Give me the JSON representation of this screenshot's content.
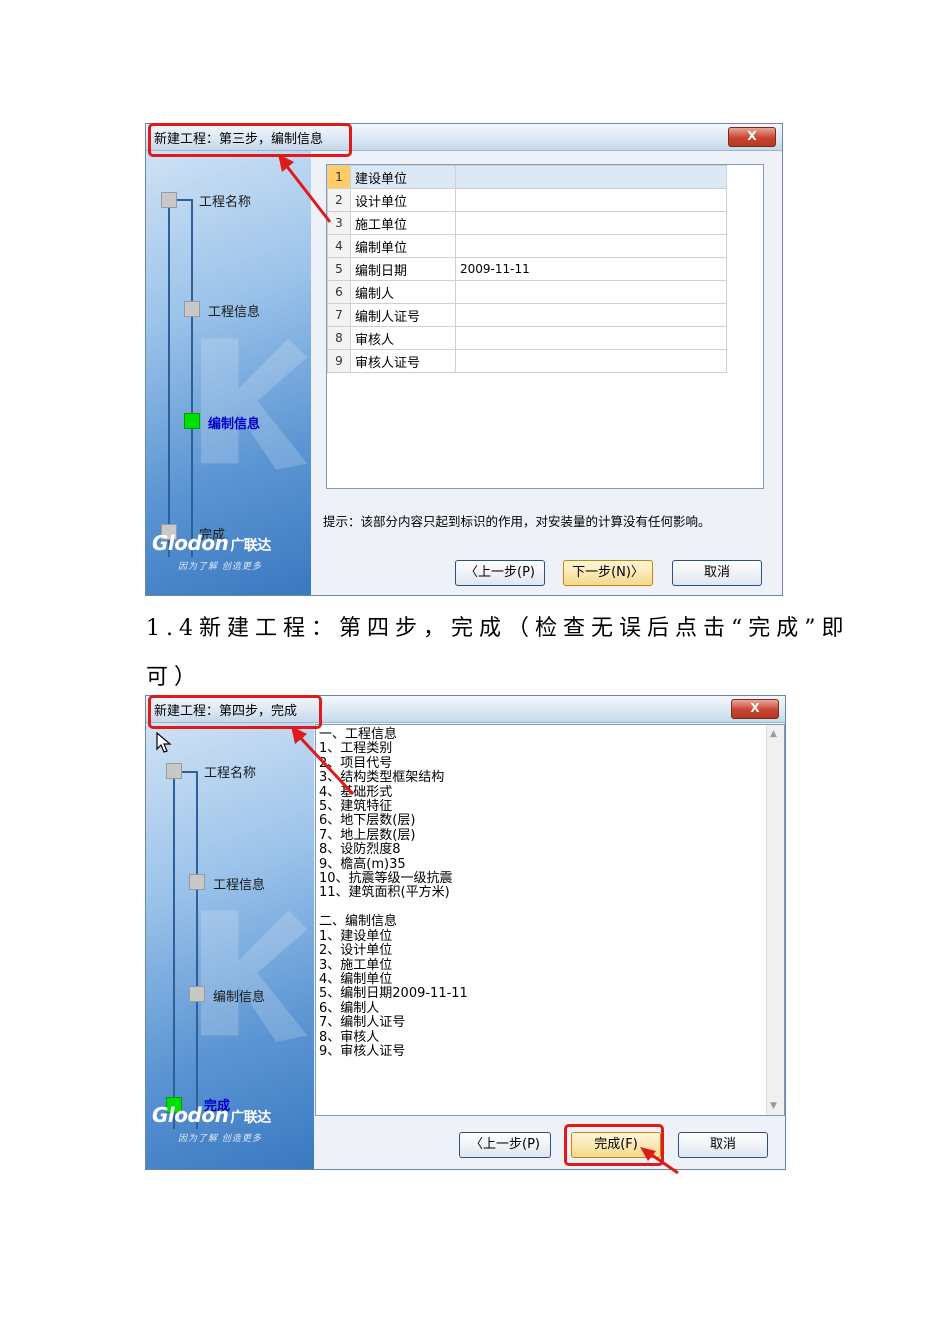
{
  "dialog1": {
    "title": "新建工程：第三步，编制信息",
    "close_label": "X",
    "steps": [
      {
        "label": "工程名称",
        "active": false
      },
      {
        "label": "工程信息",
        "active": false
      },
      {
        "label": "编制信息",
        "active": true
      },
      {
        "label": "完成",
        "active": false
      }
    ],
    "brand": {
      "logo": "Glodon",
      "name": "广联达",
      "slogan": "因为了解 创造更多"
    },
    "rows": [
      {
        "num": "1",
        "key": "建设单位",
        "value": ""
      },
      {
        "num": "2",
        "key": "设计单位",
        "value": ""
      },
      {
        "num": "3",
        "key": "施工单位",
        "value": ""
      },
      {
        "num": "4",
        "key": "编制单位",
        "value": ""
      },
      {
        "num": "5",
        "key": "编制日期",
        "value": "2009-11-11"
      },
      {
        "num": "6",
        "key": "编制人",
        "value": ""
      },
      {
        "num": "7",
        "key": "编制人证号",
        "value": ""
      },
      {
        "num": "8",
        "key": "审核人",
        "value": ""
      },
      {
        "num": "9",
        "key": "审核人证号",
        "value": ""
      }
    ],
    "hint": "提示：该部分内容只起到标识的作用，对安装量的计算没有任何影响。",
    "buttons": {
      "prev": "〈上一步(P)",
      "next": "下一步(N)〉",
      "cancel": "取消"
    }
  },
  "caption": {
    "line1": "1.4新建工程：第四步，完成（检查无误后点击“完成”即",
    "line2": "可）"
  },
  "dialog2": {
    "title": "新建工程：第四步，完成",
    "close_label": "X",
    "steps": [
      {
        "label": "工程名称",
        "active": false
      },
      {
        "label": "工程信息",
        "active": false
      },
      {
        "label": "编制信息",
        "active": false
      },
      {
        "label": "完成",
        "active": true
      }
    ],
    "brand": {
      "logo": "Glodon",
      "name": "广联达",
      "slogan": "因为了解 创造更多"
    },
    "summary": [
      "一、工程信息",
      "1、工程类别",
      "2、项目代号",
      "3、结构类型框架结构",
      "4、基础形式",
      "5、建筑特征",
      "6、地下层数(层)",
      "7、地上层数(层)",
      "8、设防烈度8",
      "9、檐高(m)35",
      "10、抗震等级一级抗震",
      "11、建筑面积(平方米)",
      "",
      "二、编制信息",
      "1、建设单位",
      "2、设计单位",
      "3、施工单位",
      "4、编制单位",
      "5、编制日期2009-11-11",
      "6、编制人",
      "7、编制人证号",
      "8、审核人",
      "9、审核人证号"
    ],
    "buttons": {
      "prev": "〈上一步(P)",
      "finish": "完成(F)",
      "cancel": "取消"
    }
  },
  "colors": {
    "highlight_red": "#e01a1a",
    "active_step": "#00e000",
    "sidebar_blue": "#5b95d3"
  }
}
